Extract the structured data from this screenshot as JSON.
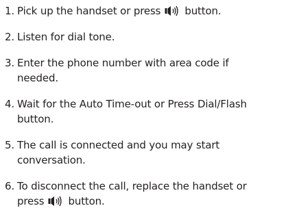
{
  "steps": [
    {
      "number": "1.",
      "parts": [
        "Pick up the handset or press",
        "button."
      ]
    },
    {
      "number": "2.",
      "lines": [
        "Listen for dial tone."
      ]
    },
    {
      "number": "3.",
      "lines": [
        "Enter the phone number with area code if",
        "needed."
      ]
    },
    {
      "number": "4.",
      "lines": [
        "Wait for the Auto Time-out or Press Dial/Flash",
        "button."
      ]
    },
    {
      "number": "5.",
      "lines": [
        "The call is connected and you may start",
        "conversation."
      ]
    },
    {
      "number": "6.",
      "lines": [
        "To disconnect the call, replace the handset or"
      ],
      "last_parts": [
        "press",
        "button."
      ]
    }
  ],
  "icons": {
    "speaker": "speakerphone-icon"
  }
}
